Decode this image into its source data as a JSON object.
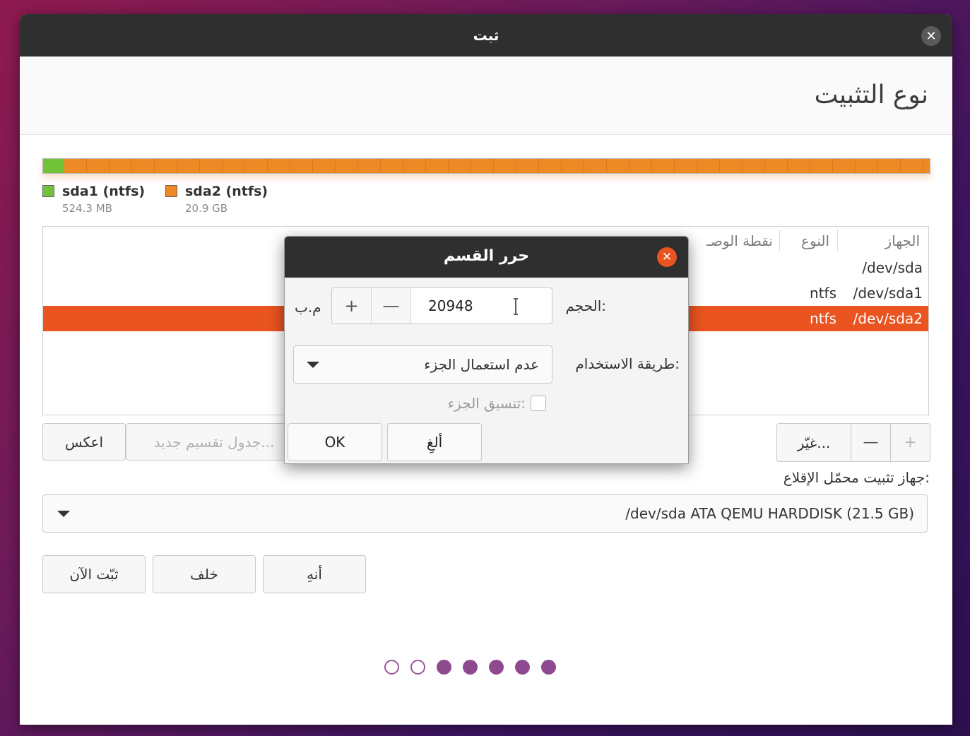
{
  "window": {
    "title": "ثبت"
  },
  "page": {
    "title": "نوع التثبيت"
  },
  "partitions": [
    {
      "name": "sda1 (ntfs)",
      "size": "524.3 MB",
      "color": "#73c33a"
    },
    {
      "name": "sda2 (ntfs)",
      "size": "20.9 GB",
      "color": "#ee8a26"
    }
  ],
  "table": {
    "headers": [
      "الجهاز",
      "النوع",
      "نقطة الوصـ"
    ],
    "rows": [
      {
        "device": "/dev/sda",
        "type": ""
      },
      {
        "device": "/dev/sda1",
        "type": "ntfs"
      },
      {
        "device": "/dev/sda2",
        "type": "ntfs",
        "selected": true
      }
    ]
  },
  "table_buttons": {
    "add": "+",
    "remove": "—",
    "change": "غيّر...",
    "new_table": "جدول تقسيم جديد...",
    "revert": "اعكس"
  },
  "bootloader": {
    "label": "جهاز تثبيت محمّل الإقلاع:",
    "value": "/dev/sda   ATA QEMU HARDDISK (21.5 GB)"
  },
  "nav_buttons": {
    "quit": "أنهِ",
    "back": "خلف",
    "install_now": "ثبّت الآن"
  },
  "progress": {
    "total_steps": 7,
    "current_step": 2
  },
  "dialog": {
    "title": "حرر القسم",
    "size_label": "الحجم:",
    "size_value": "20948",
    "size_unit": "م.ب",
    "minus": "—",
    "plus": "+",
    "use_label": "طريقة الاستخدام:",
    "use_value": "عدم استعمال الجزء",
    "format_label": "تنسيق الجزء:",
    "cancel": "ألغِ",
    "ok": "OK"
  },
  "colors": {
    "accent": "#e95420",
    "titlebar": "#2f2f2f",
    "progress_dot": "#8f4a8f"
  }
}
